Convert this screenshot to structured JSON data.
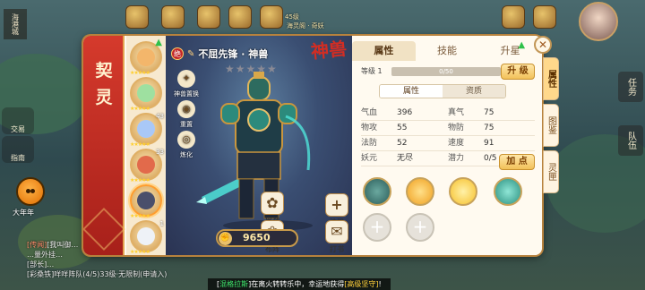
{
  "world": {
    "map_name": "海港城",
    "left_buttons": [
      "交易",
      "指南"
    ],
    "event_label": "大年年",
    "top_notes": [
      "45级",
      "海灵阁 · 奇妖"
    ],
    "chat": [
      {
        "tag": "[传闻]",
        "text": "[我叫御…"
      },
      {
        "tag": "",
        "text": "…量外挂…"
      },
      {
        "tag": "",
        "text": "[部长]…"
      },
      {
        "tag": "",
        "text": "[彩桑铁]咩咩阵队(4/5)33级·无限制(申请入)"
      }
    ],
    "marquee": {
      "prefix": "[",
      "name": "混格拉斯",
      "mid": "]在离火转转乐中，幸运地获得",
      "item": "[高级坚守]",
      "suffix": "!"
    },
    "side_tabs": [
      "任务",
      "队伍"
    ]
  },
  "panel": {
    "banner_title": "契灵",
    "pet": {
      "badge": "绝",
      "name": "不屈先锋 · 神兽",
      "stars": "★★★★★",
      "type_mark": "神兽",
      "power": "9650"
    },
    "pet_slots": [
      {
        "level": "",
        "stars": "★★★★★",
        "color": "#f3b66b"
      },
      {
        "level": "",
        "stars": "★★★★★",
        "color": "#9ee0a0"
      },
      {
        "level": "43",
        "stars": "★★★★★",
        "color": "#a9c8f7"
      },
      {
        "level": "33",
        "stars": "★★★★★",
        "color": "#e26a4b"
      },
      {
        "level": "",
        "stars": "★★★★★",
        "color": "#4a4f6b"
      },
      {
        "level": "1",
        "stars": "★★★★★",
        "color": "#eef2f7"
      }
    ],
    "tools_left": [
      {
        "icon": "✦",
        "label": "神兽置换"
      },
      {
        "icon": "◉",
        "label": "重置"
      },
      {
        "icon": "◎",
        "label": "炼化"
      }
    ],
    "tools_bottom": [
      {
        "icon": "✿",
        "label": "出战"
      },
      {
        "icon": "❀",
        "label": "布阵"
      },
      {
        "icon": "+",
        "label": "法器"
      },
      {
        "icon": "✉",
        "label": "打书"
      }
    ],
    "tabs": [
      "属性",
      "技能",
      "升星"
    ],
    "level": {
      "label": "等级 1",
      "exp": "0/50",
      "fraction": 0.0,
      "button": "升 级"
    },
    "subtabs": [
      "属性",
      "资质"
    ],
    "stats": [
      [
        {
          "k": "气血",
          "v": "396"
        },
        {
          "k": "真气",
          "v": "75"
        }
      ],
      [
        {
          "k": "物攻",
          "v": "55"
        },
        {
          "k": "物防",
          "v": "75"
        }
      ],
      [
        {
          "k": "法防",
          "v": "52"
        },
        {
          "k": "速度",
          "v": "91"
        }
      ],
      [
        {
          "k": "妖元",
          "v": "无尽"
        },
        {
          "k": "潜力",
          "v": "0/5"
        }
      ]
    ],
    "add_point_button": "加 点",
    "skills": [
      {
        "color": "#2b5d5a",
        "empty": false
      },
      {
        "color": "#f0a020",
        "empty": false
      },
      {
        "color": "#f6c02c",
        "empty": false
      },
      {
        "color": "#2a8f7f",
        "empty": false
      },
      {
        "color": "",
        "empty": true
      },
      {
        "color": "",
        "empty": true
      }
    ],
    "right_tabs": [
      "属性",
      "图鉴",
      "灵匣"
    ]
  }
}
